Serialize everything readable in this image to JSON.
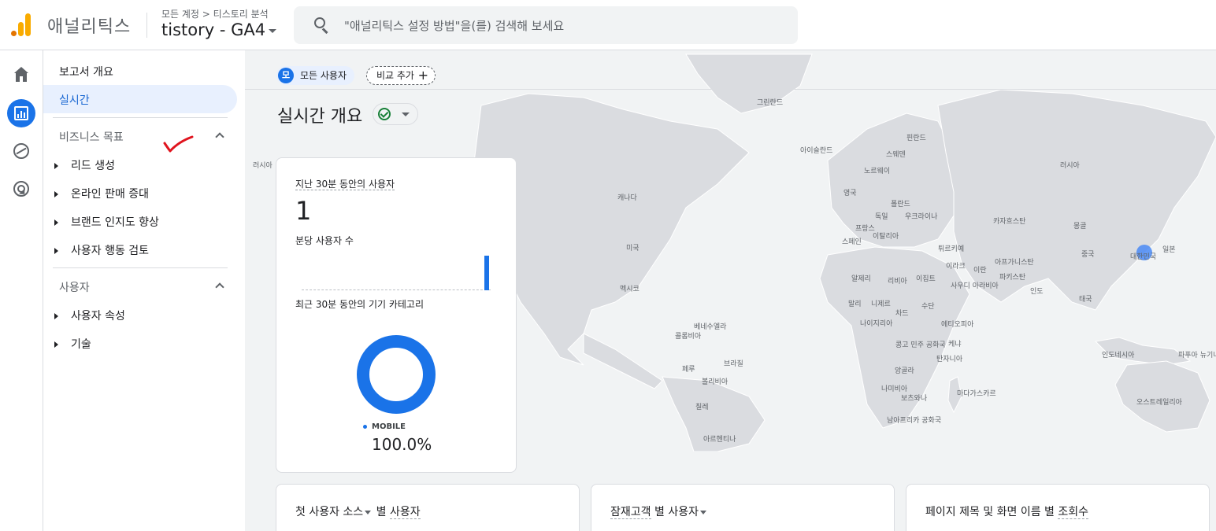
{
  "header": {
    "app_name": "애널리틱스",
    "breadcrumb": "모든 계정 > 티스토리 분석",
    "property_name": "tistory - GA4",
    "search_placeholder": "\"애널리틱스 설정 방법\"을(를) 검색해 보세요"
  },
  "nav": {
    "overview": "보고서 개요",
    "realtime": "실시간",
    "sections": [
      {
        "title": "비즈니스 목표",
        "items": [
          "리드 생성",
          "온라인 판매 증대",
          "브랜드 인지도 향상",
          "사용자 행동 검토"
        ]
      },
      {
        "title": "사용자",
        "items": [
          "사용자 속성",
          "기술"
        ]
      }
    ]
  },
  "main": {
    "segment_chip": {
      "avatar": "모",
      "label": "모든 사용자"
    },
    "compare_label": "비교 추가",
    "title": "실시간 개요",
    "realtime_card": {
      "users_label": "지난 30분 동안의 사용자",
      "users_value": "1",
      "per_minute_label": "분당 사용자 수",
      "device_label": "최근 30분 동안의 기기 카테고리",
      "device_legend": "MOBILE",
      "device_pct": "100.0%"
    },
    "bottom_cards": [
      {
        "prefix": "첫 사용자 소스",
        "suffix": " 별 ",
        "metric": "사용자"
      },
      {
        "prefix": "잠재고객",
        "suffix": " 별 ",
        "metric": "사용자"
      },
      {
        "prefix": "페이지 제목 및 화면 이름",
        "suffix": " 별 ",
        "metric": "조회수"
      }
    ]
  },
  "map_labels": [
    "그린란드",
    "아이슬란드",
    "핀란드",
    "스웨덴",
    "노르웨이",
    "러시아",
    "러시아",
    "캐나다",
    "영국",
    "폴란드",
    "독일",
    "우크라이나",
    "카자흐스탄",
    "몽골",
    "프랑스",
    "이탈리아",
    "스페인",
    "튀르키예",
    "미국",
    "중국",
    "일본",
    "대한민국",
    "이라크",
    "이란",
    "아프가니스탄",
    "파키스탄",
    "알제리",
    "리비아",
    "이집트",
    "사우디 아라비아",
    "멕시코",
    "인도",
    "말리",
    "니제르",
    "수단",
    "태국",
    "차드",
    "나이지리아",
    "에티오피아",
    "베네수엘라",
    "콜롬비아",
    "콩고 민주 공화국",
    "케냐",
    "탄자니아",
    "인도네시아",
    "파푸아 뉴기니",
    "페루",
    "브라질",
    "앙골라",
    "볼리비아",
    "나미비아",
    "보츠와나",
    "마다가스카르",
    "칠레",
    "오스트레일리아",
    "남아프리카 공화국",
    "아르헨티나"
  ],
  "per_minute_series": [
    0,
    0,
    0,
    0,
    0,
    0,
    0,
    0,
    0,
    0,
    0,
    0,
    0,
    0,
    0,
    0,
    0,
    0,
    0,
    0,
    0,
    0,
    0,
    0,
    0,
    0,
    0,
    0,
    0,
    1
  ],
  "colors": {
    "accent": "#1a73e8",
    "map_land": "#dadce0",
    "map_bg": "#f1f3f4"
  }
}
